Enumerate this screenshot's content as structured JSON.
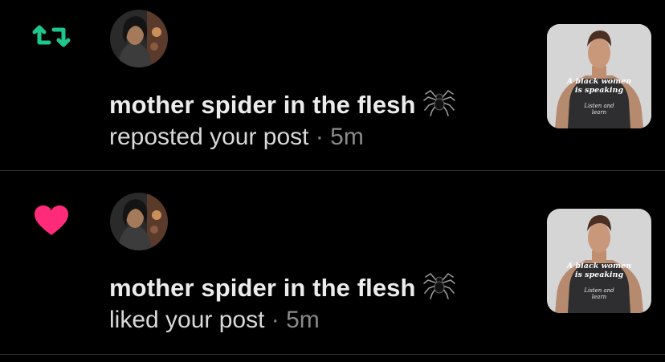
{
  "notifications": [
    {
      "type": "repost",
      "icon": "repost-icon",
      "icon_color": "#1fc68b",
      "user_name": "mother spider in the flesh",
      "name_emoji": "spider-icon",
      "action_text": "reposted your post",
      "separator": "·",
      "time": "5m",
      "thumbnail": {
        "shirt_line1": "A black women",
        "shirt_line2": "is speaking",
        "shirt_line3": "Listen and",
        "shirt_line4": "learn"
      }
    },
    {
      "type": "like",
      "icon": "heart-icon",
      "icon_color": "#ff2a78",
      "user_name": "mother spider in the flesh",
      "name_emoji": "spider-icon",
      "action_text": "liked your post",
      "separator": "·",
      "time": "5m",
      "thumbnail": {
        "shirt_line1": "A black women",
        "shirt_line2": "is speaking",
        "shirt_line3": "Listen and",
        "shirt_line4": "learn"
      }
    }
  ]
}
